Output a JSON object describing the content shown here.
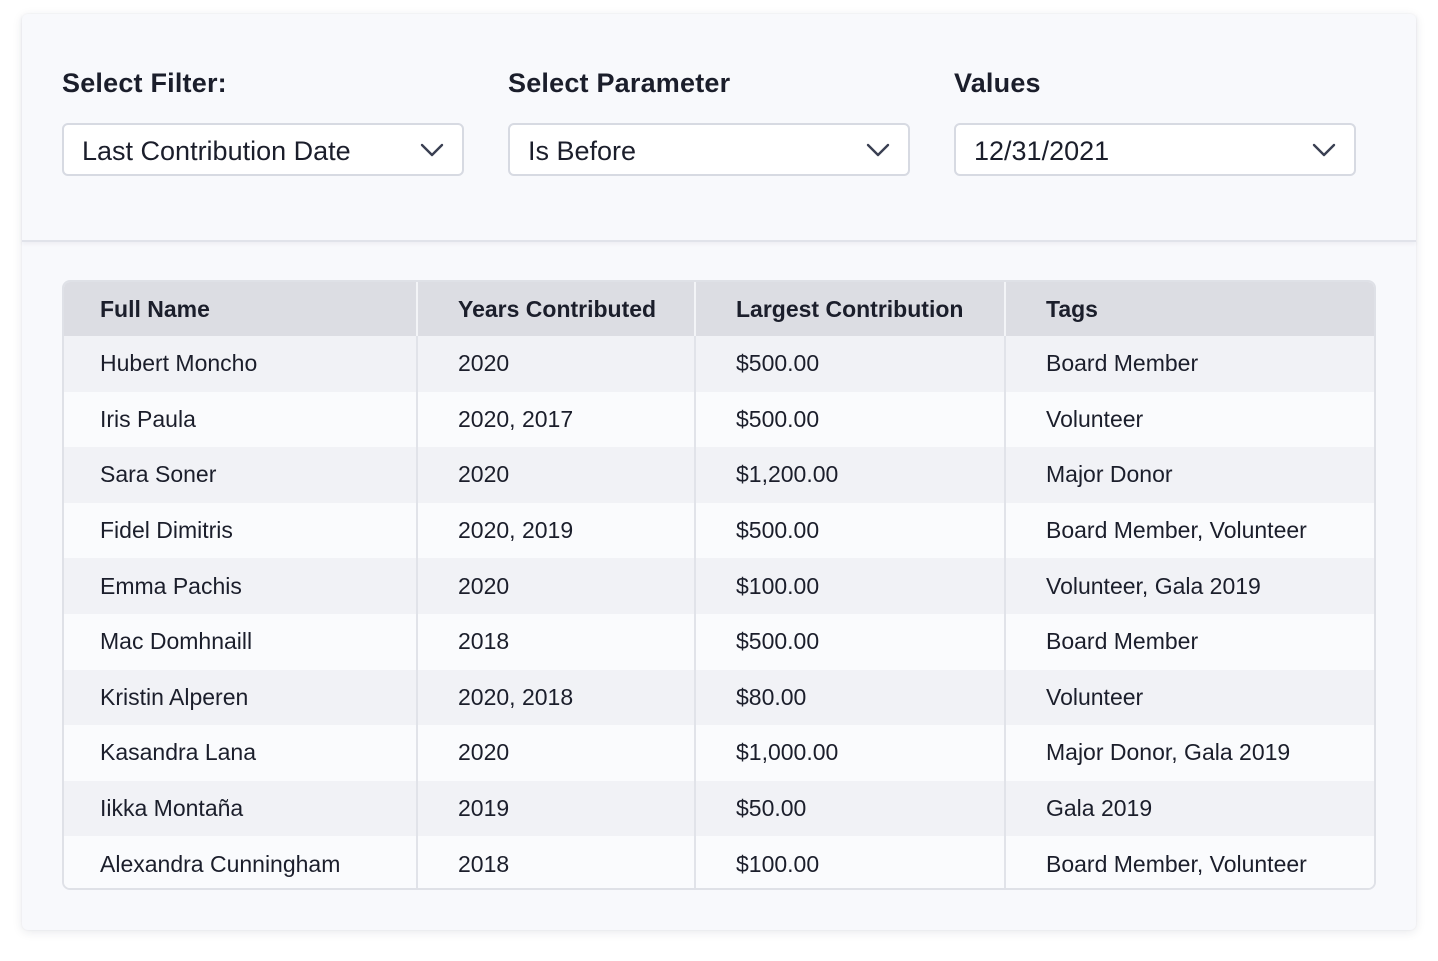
{
  "filters": [
    {
      "label": "Select Filter:",
      "value": "Last Contribution Date"
    },
    {
      "label": "Select Parameter",
      "value": "Is Before"
    },
    {
      "label": "Values",
      "value": "12/31/2021"
    }
  ],
  "table": {
    "headers": [
      "Full Name",
      "Years Contributed",
      "Largest Contribution",
      "Tags"
    ],
    "rows": [
      [
        "Hubert Moncho",
        "2020",
        "$500.00",
        "Board Member"
      ],
      [
        "Iris Paula",
        "2020, 2017",
        "$500.00",
        "Volunteer"
      ],
      [
        "Sara Soner",
        "2020",
        "$1,200.00",
        "Major Donor"
      ],
      [
        "Fidel Dimitris",
        "2020, 2019",
        "$500.00",
        "Board Member,  Volunteer"
      ],
      [
        "Emma Pachis",
        "2020",
        "$100.00",
        "Volunteer, Gala 2019"
      ],
      [
        "Mac Domhnaill",
        "2018",
        "$500.00",
        "Board Member"
      ],
      [
        "Kristin Alperen",
        "2020, 2018",
        "$80.00",
        "Volunteer"
      ],
      [
        "Kasandra Lana",
        "2020",
        "$1,000.00",
        "Major Donor, Gala 2019"
      ],
      [
        "Iikka Montaña",
        "2019",
        "$50.00",
        "Gala 2019"
      ],
      [
        "Alexandra Cunningham",
        "2018",
        "$100.00",
        "Board Member, Volunteer"
      ]
    ]
  },
  "icons": {
    "dropdown": "chevron-down-icon"
  },
  "colors": {
    "panel_background": "#f8f9fc",
    "header_row": "#dcdde3",
    "stripe_row": "#f1f2f6",
    "text": "#1b1e2b"
  }
}
